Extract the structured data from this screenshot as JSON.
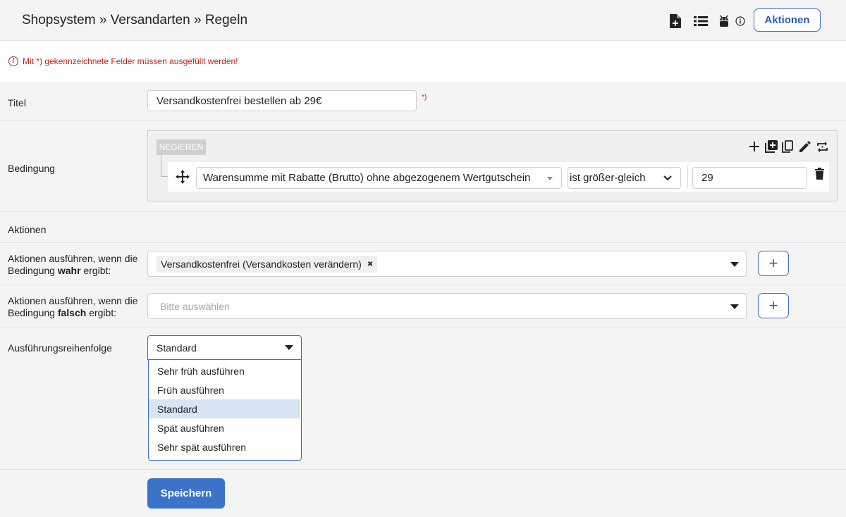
{
  "header": {
    "breadcrumb": "Shopsystem » Versandarten » Regeln",
    "actions_label": "Aktionen",
    "icons": [
      "new-document-icon",
      "list-icon",
      "android-icon",
      "info-icon"
    ]
  },
  "notice": {
    "icon_glyph": "!",
    "text": "Mit *) gekennzeichnete Felder müssen ausgefüllt werden!"
  },
  "titel": {
    "label": "Titel",
    "value": "Versandkostenfrei bestellen ab 29€",
    "required_mark": "*)"
  },
  "bedingung": {
    "label": "Bedingung",
    "negate_label": "NEGIEREN",
    "toolbar_icons": [
      "plus-icon",
      "add-group-icon",
      "copy-icon",
      "pencil-icon",
      "swap-icon"
    ],
    "field": "Warensumme mit Rabatte (Brutto) ohne abgezogenem Wertgutschein",
    "operator": "ist größer-gleich",
    "value": "29"
  },
  "aktionen": {
    "section_label": "Aktionen",
    "true_label_prefix": "Aktionen ausführen, wenn die Bedingung ",
    "true_label_bold": "wahr",
    "true_label_suffix": " ergibt:",
    "true_tag": "Versandkostenfrei (Versandkosten verändern)",
    "tag_remove": "✖",
    "false_label_prefix": "Aktionen ausführen, wenn die Bedingung ",
    "false_label_bold": "falsch",
    "false_label_suffix": " ergibt:",
    "false_placeholder": "Bitte auswählen",
    "add_label": "+"
  },
  "reihenfolge": {
    "label": "Ausführungsreihenfolge",
    "selected": "Standard",
    "options": [
      "Sehr früh ausführen",
      "Früh ausführen",
      "Standard",
      "Spät ausführen",
      "Sehr spät ausführen"
    ]
  },
  "save_label": "Speichern",
  "colors": {
    "accent": "#3b73c9",
    "error": "#c0271c",
    "selected_option": "#d6e4f3"
  }
}
